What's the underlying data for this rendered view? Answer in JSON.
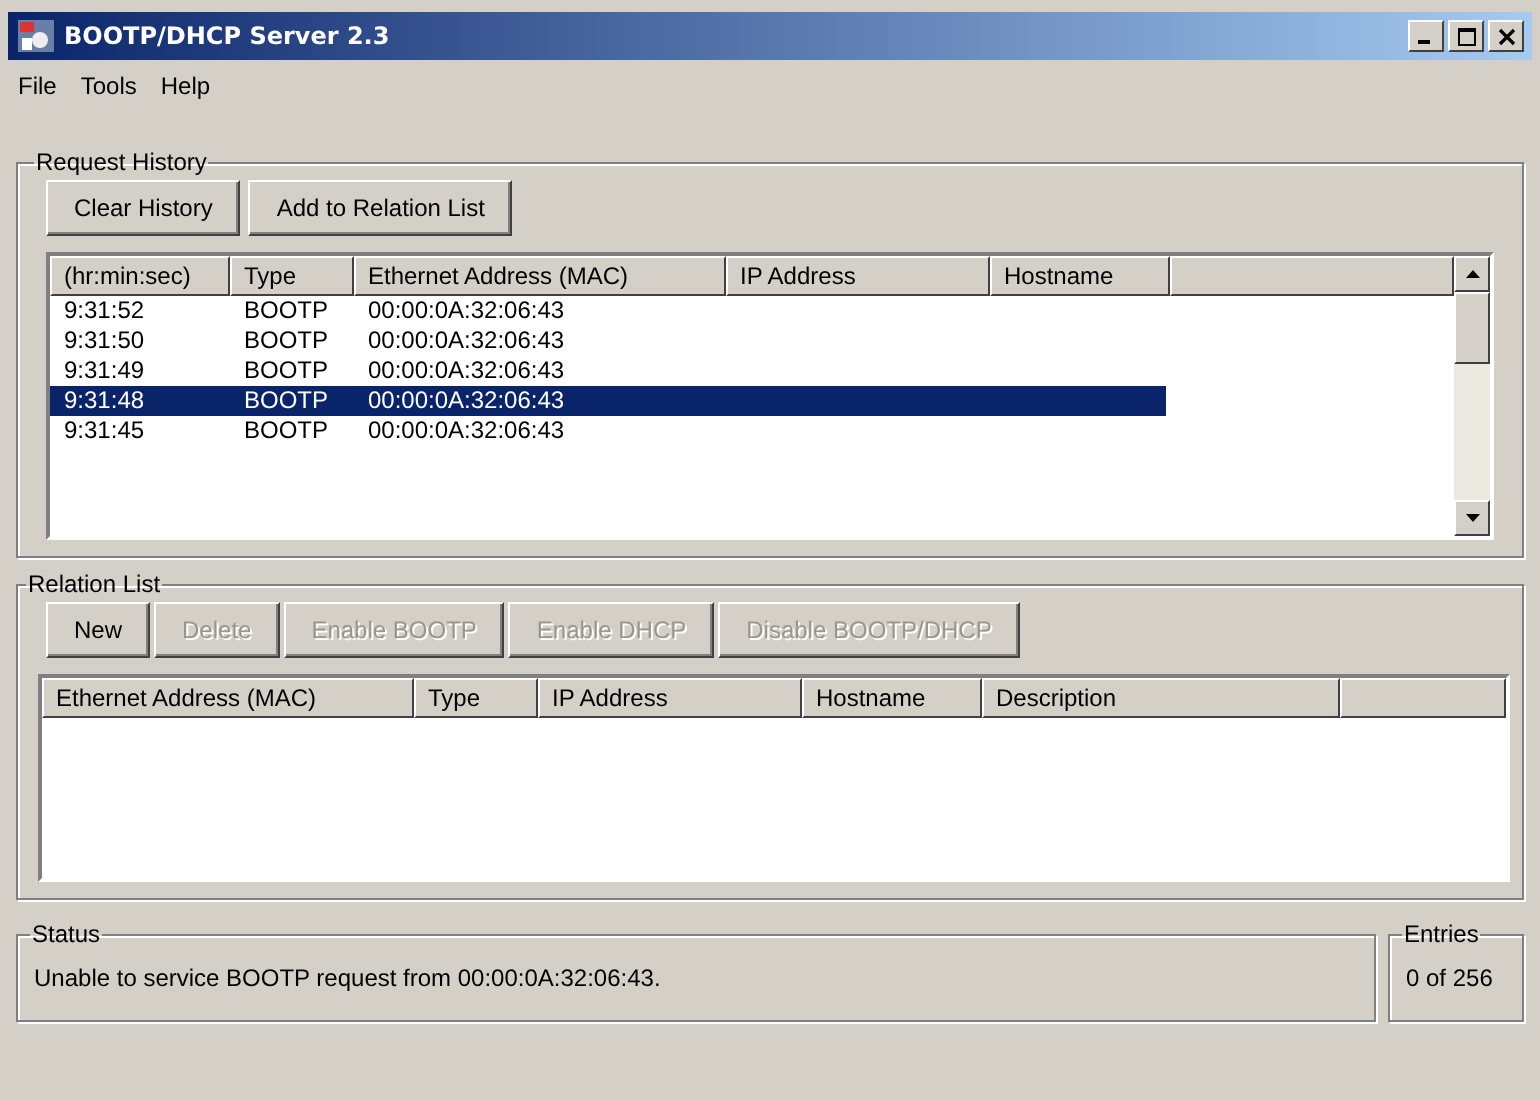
{
  "window": {
    "title": "BOOTP/DHCP Server 2.3"
  },
  "menu": [
    "File",
    "Tools",
    "Help"
  ],
  "request_history": {
    "title": "Request History",
    "buttons": [
      {
        "label": "Clear History",
        "disabled": false
      },
      {
        "label": "Add to Relation List",
        "disabled": false
      }
    ],
    "columns": [
      "(hr:min:sec)",
      "Type",
      "Ethernet Address (MAC)",
      "IP Address",
      "Hostname"
    ],
    "rows": [
      {
        "cells": [
          "9:31:52",
          "BOOTP",
          "00:00:0A:32:06:43"
        ],
        "selected": false
      },
      {
        "cells": [
          "9:31:50",
          "BOOTP",
          "00:00:0A:32:06:43"
        ],
        "selected": false
      },
      {
        "cells": [
          "9:31:49",
          "BOOTP",
          "00:00:0A:32:06:43"
        ],
        "selected": false
      },
      {
        "cells": [
          "9:31:48",
          "BOOTP",
          "00:00:0A:32:06:43"
        ],
        "selected": true
      },
      {
        "cells": [
          "9:31:45",
          "BOOTP",
          "00:00:0A:32:06:43"
        ],
        "selected": false
      }
    ]
  },
  "relation_list": {
    "title": "Relation List",
    "buttons": [
      {
        "label": "New",
        "disabled": false
      },
      {
        "label": "Delete",
        "disabled": true
      },
      {
        "label": "Enable BOOTP",
        "disabled": true
      },
      {
        "label": "Enable DHCP",
        "disabled": true
      },
      {
        "label": "Disable BOOTP/DHCP",
        "disabled": true
      }
    ],
    "columns": [
      "Ethernet Address (MAC)",
      "Type",
      "IP Address",
      "Hostname",
      "Description"
    ]
  },
  "status": {
    "title": "Status",
    "message": "Unable to service BOOTP request from 00:00:0A:32:06:43."
  },
  "entries": {
    "title": "Entries",
    "value": "0 of 256"
  }
}
